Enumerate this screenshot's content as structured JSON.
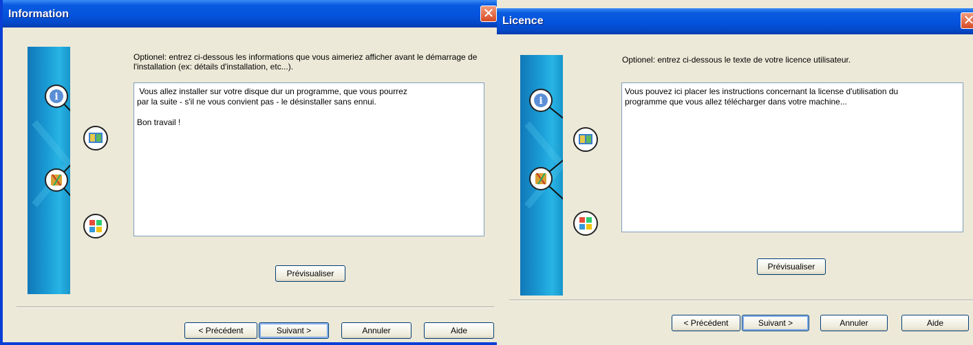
{
  "dialogs": [
    {
      "title": "Information",
      "close": "✕",
      "instructions": "Optionel: entrez ci-dessous les informations que vous aimeriez afficher avant le démarrage de l'installation (ex: détails d'installation, etc...).",
      "text_content": " Vous allez installer sur votre disque dur un programme, que vous pourrez\npar la suite - s'il ne vous convient pas - le désinstaller sans ennui.\n\nBon travail !",
      "preview_button": "Prévisualiser",
      "buttons": {
        "previous": "< Précédent",
        "next": "Suivant >",
        "cancel": "Annuler",
        "help": "Aide"
      }
    },
    {
      "title": "Licence",
      "close": "✕",
      "instructions": "Optionel: entrez ci-dessous le texte de votre licence utilisateur.",
      "text_content": "Vous pouvez ici placer les instructions concernant la license d'utilisation du\nprogramme que vous allez télécharger dans votre machine...",
      "preview_button": "Prévisualiser",
      "buttons": {
        "previous": "< Précédent",
        "next": "Suivant >",
        "cancel": "Annuler",
        "help": "Aide"
      }
    }
  ],
  "banner_icons": [
    "info-icon",
    "book-icon",
    "tools-icon",
    "windows-logo-icon"
  ],
  "colors": {
    "titlebar": "#0553dd",
    "dialog_bg": "#ece9d8",
    "close": "#d74a25",
    "banner": "#1a9ad4",
    "desktop": "#e8f4ec"
  }
}
